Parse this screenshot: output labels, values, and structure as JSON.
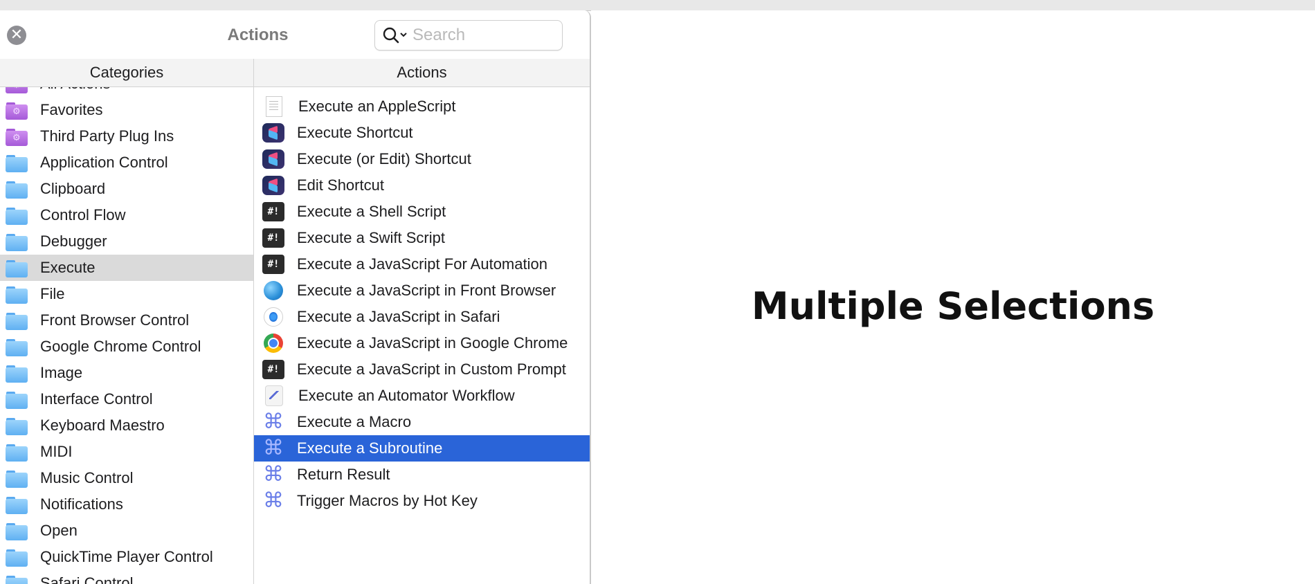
{
  "header": {
    "title": "Actions",
    "close_icon": "close-icon",
    "search": {
      "placeholder": "Search",
      "value": "",
      "icon": "search-icon"
    }
  },
  "columns": {
    "categories": "Categories",
    "actions": "Actions"
  },
  "categories": [
    {
      "label": "All Actions",
      "icon": "folder-purple-gear-icon"
    },
    {
      "label": "Favorites",
      "icon": "folder-purple-gear-icon"
    },
    {
      "label": "Third Party Plug Ins",
      "icon": "folder-purple-gear-icon"
    },
    {
      "label": "Application Control",
      "icon": "folder-icon"
    },
    {
      "label": "Clipboard",
      "icon": "folder-icon"
    },
    {
      "label": "Control Flow",
      "icon": "folder-icon"
    },
    {
      "label": "Debugger",
      "icon": "folder-icon"
    },
    {
      "label": "Execute",
      "icon": "folder-icon",
      "selected": true
    },
    {
      "label": "File",
      "icon": "folder-icon"
    },
    {
      "label": "Front Browser Control",
      "icon": "folder-icon"
    },
    {
      "label": "Google Chrome Control",
      "icon": "folder-icon"
    },
    {
      "label": "Image",
      "icon": "folder-icon"
    },
    {
      "label": "Interface Control",
      "icon": "folder-icon"
    },
    {
      "label": "Keyboard Maestro",
      "icon": "folder-icon"
    },
    {
      "label": "MIDI",
      "icon": "folder-icon"
    },
    {
      "label": "Music Control",
      "icon": "folder-icon"
    },
    {
      "label": "Notifications",
      "icon": "folder-icon"
    },
    {
      "label": "Open",
      "icon": "folder-icon"
    },
    {
      "label": "QuickTime Player Control",
      "icon": "folder-icon"
    },
    {
      "label": "Safari Control",
      "icon": "folder-icon"
    }
  ],
  "actions": [
    {
      "label": "Execute an AppleScript",
      "icon": "script-document-icon"
    },
    {
      "label": "Execute Shortcut",
      "icon": "shortcuts-icon"
    },
    {
      "label": "Execute (or Edit) Shortcut",
      "icon": "shortcuts-icon"
    },
    {
      "label": "Edit Shortcut",
      "icon": "shortcuts-icon"
    },
    {
      "label": "Execute a Shell Script",
      "icon": "terminal-icon",
      "glyph": "#!"
    },
    {
      "label": "Execute a Swift Script",
      "icon": "terminal-icon",
      "glyph": "#!"
    },
    {
      "label": "Execute a JavaScript For Automation",
      "icon": "terminal-icon",
      "glyph": "#!"
    },
    {
      "label": "Execute a JavaScript in Front Browser",
      "icon": "globe-icon"
    },
    {
      "label": "Execute a JavaScript in Safari",
      "icon": "safari-icon"
    },
    {
      "label": "Execute a JavaScript in Google Chrome",
      "icon": "chrome-icon"
    },
    {
      "label": "Execute a JavaScript in Custom Prompt",
      "icon": "terminal-icon",
      "glyph": "#!"
    },
    {
      "label": "Execute an Automator Workflow",
      "icon": "automator-icon"
    },
    {
      "label": "Execute a Macro",
      "icon": "command-key-icon"
    },
    {
      "label": "Execute a Subroutine",
      "icon": "command-key-icon",
      "selected": true
    },
    {
      "label": "Return Result",
      "icon": "command-key-icon"
    },
    {
      "label": "Trigger Macros by Hot Key",
      "icon": "command-key-icon"
    }
  ],
  "main": {
    "message": "Multiple Selections"
  },
  "colors": {
    "selection_blue": "#2a64d8",
    "selection_grey": "#dadada"
  }
}
